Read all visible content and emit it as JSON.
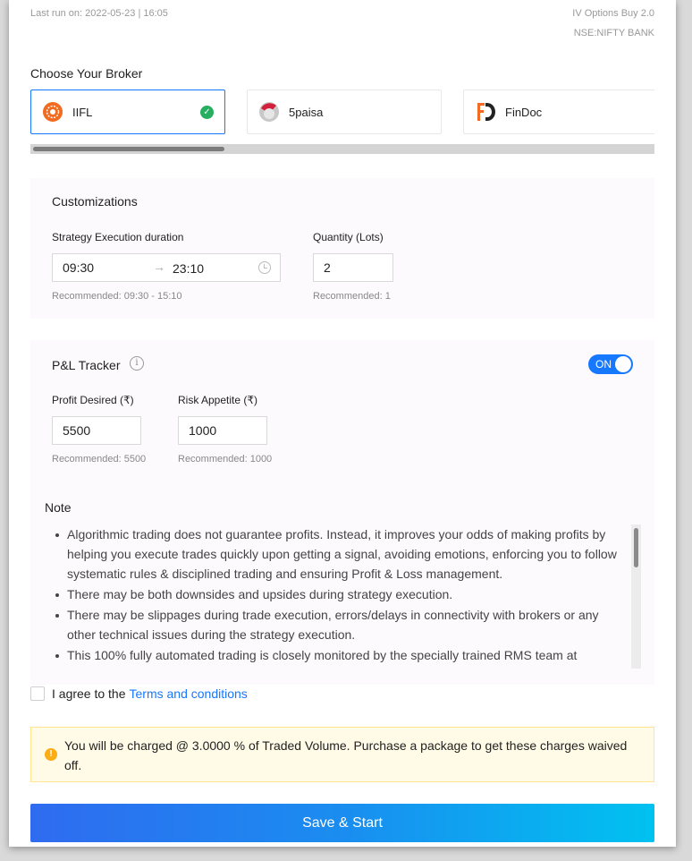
{
  "header": {
    "last_run": "Last run on: 2022-05-23 | 16:05",
    "strategy_name": "IV Options Buy 2.0",
    "instrument": "NSE:NIFTY BANK"
  },
  "broker": {
    "title": "Choose Your Broker",
    "items": [
      {
        "label": "IIFL",
        "selected": true
      },
      {
        "label": "5paisa",
        "selected": false
      },
      {
        "label": "FinDoc",
        "selected": false
      }
    ]
  },
  "customizations": {
    "title": "Customizations",
    "duration_label": "Strategy Execution duration",
    "start_time": "09:30",
    "end_time": "23:10",
    "duration_hint": "Recommended: 09:30 - 15:10",
    "quantity_label": "Quantity (Lots)",
    "quantity_value": "2",
    "quantity_hint": "Recommended: 1"
  },
  "pnl": {
    "title": "P&L Tracker",
    "toggle_label": "ON",
    "profit_label": "Profit Desired (₹)",
    "profit_value": "5500",
    "profit_hint": "Recommended: 5500",
    "risk_label": "Risk Appetite (₹)",
    "risk_value": "1000",
    "risk_hint": "Recommended: 1000"
  },
  "note": {
    "title": "Note",
    "items": [
      "Algorithmic trading does not guarantee profits. Instead, it improves your odds of making profits by helping you execute trades quickly upon getting a signal, avoiding emotions, enforcing you to follow systematic rules & disciplined trading and ensuring Profit & Loss management.",
      "There may be both downsides and upsides during strategy execution.",
      "There may be slippages during trade execution, errors/delays in connectivity with brokers or any other technical issues during the strategy execution.",
      "This 100% fully automated trading is closely monitored by the specially trained RMS team at"
    ]
  },
  "agree": {
    "prefix": "I agree to the",
    "link": "Terms and conditions"
  },
  "warning": {
    "text": "You will be charged @ 3.0000 % of Traded Volume. Purchase a package to get these charges waived off."
  },
  "actions": {
    "save_label": "Save & Start"
  },
  "colors": {
    "accent": "#1677ff",
    "success": "#27ae60",
    "warning": "#faad14"
  }
}
